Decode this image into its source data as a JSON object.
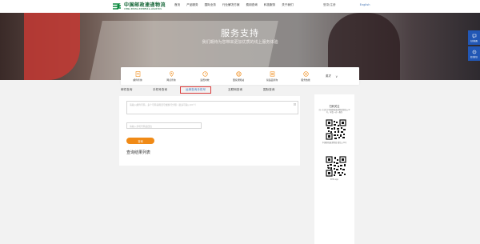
{
  "header": {
    "logo_cn": "中国邮政速递物流",
    "logo_en": "CHINA POSTAL EXPRESS & LOGISTICS",
    "nav": [
      "首页",
      "产品服务",
      "国际业务",
      "行业解决方案",
      "费用查询",
      "科技服务",
      "关于我们"
    ],
    "login": "登录/注册",
    "english": "English"
  },
  "hero": {
    "title": "服务支持",
    "subtitle": "我们期待为您带来更加优质的线上服务体验"
  },
  "side_tools": [
    {
      "label": "在线客服",
      "icon": "chat-icon"
    },
    {
      "label": "投诉建议",
      "icon": "feedback-icon"
    }
  ],
  "services": [
    {
      "label": "邮件查询",
      "icon": "document-icon"
    },
    {
      "label": "网点查询",
      "icon": "location-icon"
    },
    {
      "label": "运费时效",
      "icon": "clock-icon"
    },
    {
      "label": "国家通知站",
      "icon": "globe-icon"
    },
    {
      "label": "禁运品查询",
      "icon": "list-icon"
    },
    {
      "label": "服务热线",
      "icon": "phone-icon"
    }
  ],
  "language": {
    "label": "英才",
    "chevron": "∨"
  },
  "tabs": [
    {
      "label": "邮件查询",
      "active": false
    },
    {
      "label": "手机号查询",
      "active": false
    },
    {
      "label": "运单查询手机号",
      "active": true
    },
    {
      "label": "互联网查询",
      "active": false
    },
    {
      "label": "国际查询",
      "active": false
    }
  ],
  "form": {
    "textarea_placeholder": "请输入邮件号码，多个号码请用逗号或换行分隔（最多可输入20个）",
    "phone_placeholder": "请输入手机号码后四位",
    "query_button": "查询",
    "result_title": "查询结果列表"
  },
  "right_panel": {
    "title": "扫码关注",
    "desc": "扫一扫关注中国邮政速递物流微信公众号，享受一对一服务",
    "qr1_caption": "中国邮政速递物流 微信公众号",
    "qr2_caption": "EMS app"
  },
  "colors": {
    "brand_green": "#0a5f2e",
    "accent_orange": "#f08a16",
    "active_tab_border": "#d93a3a",
    "side_blue": "#2257b5"
  }
}
